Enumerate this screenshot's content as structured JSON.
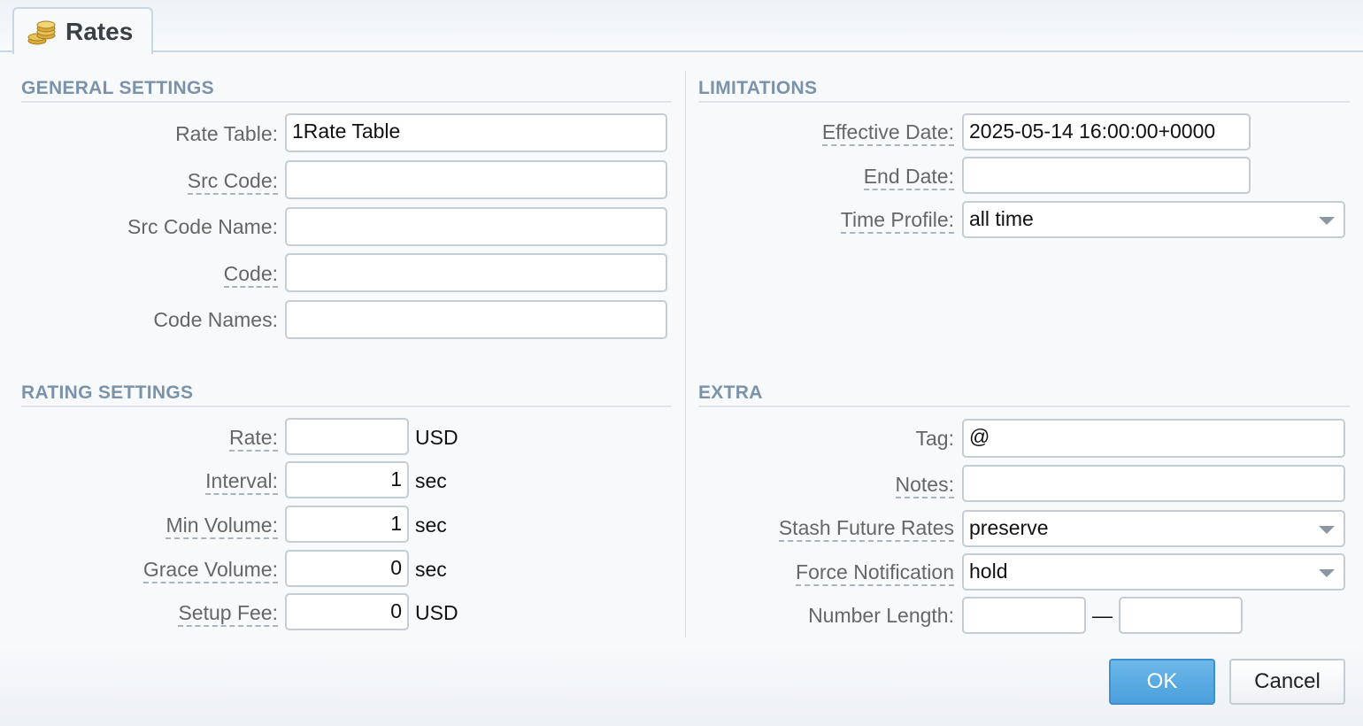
{
  "tab": {
    "label": "Rates",
    "icon": "coins-icon"
  },
  "general": {
    "title": "GENERAL SETTINGS",
    "rate_table_label": "Rate Table:",
    "rate_table_value": "1Rate Table",
    "src_code_label": "Src Code:",
    "src_code_value": "",
    "src_code_name_label": "Src Code Name:",
    "src_code_name_value": "",
    "code_label": "Code:",
    "code_value": "",
    "code_names_label": "Code Names:",
    "code_names_value": ""
  },
  "rating": {
    "title": "RATING SETTINGS",
    "rate_label": "Rate:",
    "rate_value": "",
    "rate_unit": "USD",
    "interval_label": "Interval:",
    "interval_value": "1",
    "interval_unit": "sec",
    "min_volume_label": "Min Volume:",
    "min_volume_value": "1",
    "min_volume_unit": "sec",
    "grace_volume_label": "Grace Volume:",
    "grace_volume_value": "0",
    "grace_volume_unit": "sec",
    "setup_fee_label": "Setup Fee:",
    "setup_fee_value": "0",
    "setup_fee_unit": "USD"
  },
  "limitations": {
    "title": "LIMITATIONS",
    "effective_date_label": "Effective Date:",
    "effective_date_value": "2025-05-14 16:00:00+0000",
    "end_date_label": "End Date:",
    "end_date_value": "",
    "time_profile_label": "Time Profile:",
    "time_profile_value": "all time"
  },
  "extra": {
    "title": "EXTRA",
    "tag_label": "Tag:",
    "tag_value": "@",
    "notes_label": "Notes:",
    "notes_value": "",
    "stash_label": "Stash Future Rates",
    "stash_value": "preserve",
    "force_label": "Force Notification",
    "force_value": "hold",
    "number_length_label": "Number Length:",
    "number_length_from": "",
    "number_length_sep": "—",
    "number_length_to": ""
  },
  "buttons": {
    "ok": "OK",
    "cancel": "Cancel"
  }
}
